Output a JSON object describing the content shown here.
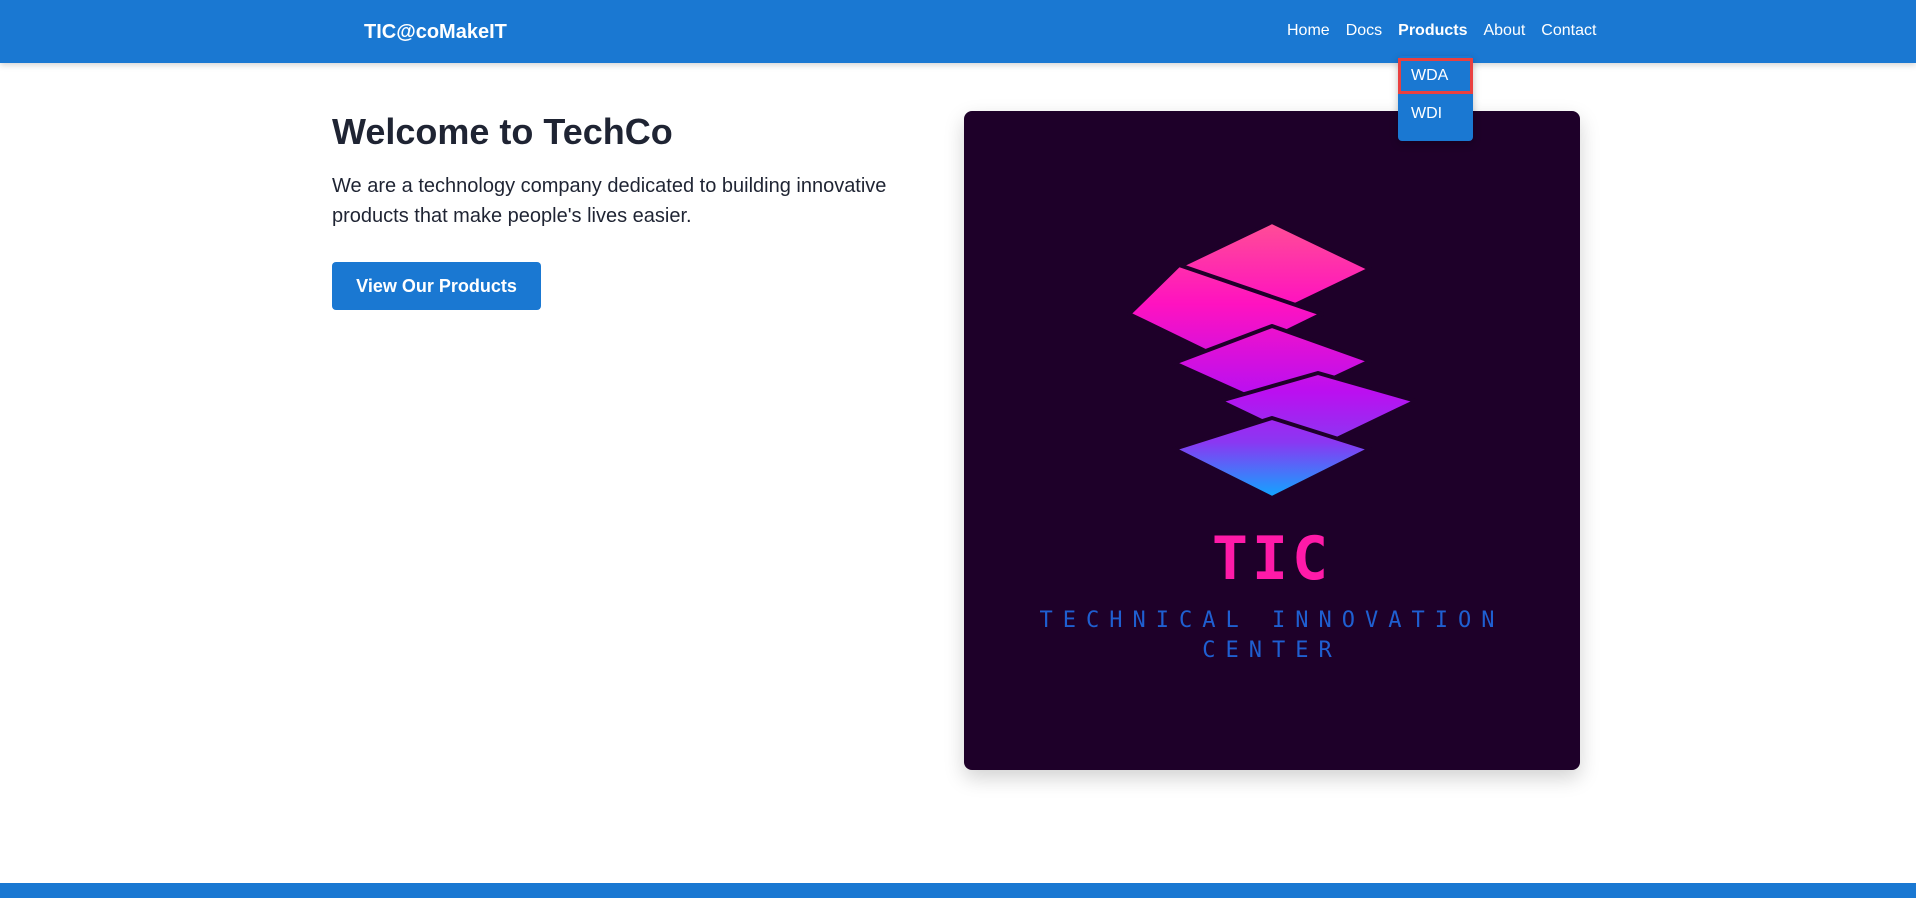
{
  "header": {
    "brand": "TIC@coMakeIT",
    "nav": [
      {
        "label": "Home",
        "active": false
      },
      {
        "label": "Docs",
        "active": false
      },
      {
        "label": "Products",
        "active": true
      },
      {
        "label": "About",
        "active": false
      },
      {
        "label": "Contact",
        "active": false
      }
    ],
    "products_dropdown": [
      {
        "label": "WDA",
        "highlighted": true
      },
      {
        "label": "WDI",
        "highlighted": false
      }
    ]
  },
  "hero": {
    "title": "Welcome to TechCo",
    "description": "We are a technology company dedicated to building innovative products that make people's lives easier.",
    "cta_label": "View Our Products"
  },
  "logo": {
    "title": "TIC",
    "subtitle": "TECHNICAL INNOVATION CENTER"
  },
  "colors": {
    "primary": "#1a78d2",
    "highlight_border": "#e94040",
    "logo_background": "#1e0029",
    "logo_pink": "#ff1aa8",
    "logo_blue": "#1f5fd1"
  }
}
